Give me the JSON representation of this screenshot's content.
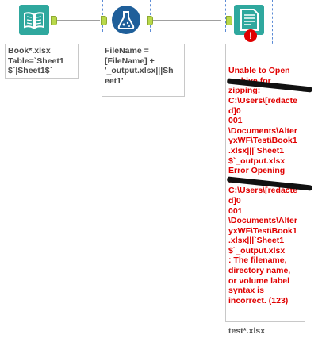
{
  "canvas": {
    "tools": [
      {
        "name": "Input Data",
        "icon": "book-icon",
        "annotation": "Book*.xlsx\nTable=`Sheet1\n$`|Sheet1$`"
      },
      {
        "name": "Formula",
        "icon": "flask-icon",
        "annotation": "FileName =\n[FileName] +\n'_output.xlsx|||Sh\neet1'"
      },
      {
        "name": "Output Data",
        "icon": "output-document-icon",
        "status": "error",
        "annotation_error": "Unable to Open\narchive for\nzipping:\nC:\\Users\\[redacted]0\n001\n\\Documents\\Alter\nyxWF\\Test\\Book1\n.xlsx|||`Sheet1\n$`_output.xlsx\nError Opening\nfile:\nC:\\Users\\[redacted]0\n001\n\\Documents\\Alter\nyxWF\\Test\\Book1\n.xlsx|||`Sheet1\n$`_output.xlsx\n: The filename,\ndirectory name,\nor volume label\nsyntax is\nincorrect. (123)",
        "annotation_footer": "test*.xlsx"
      }
    ],
    "colors": {
      "error": "#e00000",
      "anchor": "#b8d84a",
      "input_tool": "#2fa89e",
      "formula_tool": "#1f5f9a",
      "output_tool": "#2fa89e",
      "guide": "#5b8bd6"
    }
  }
}
